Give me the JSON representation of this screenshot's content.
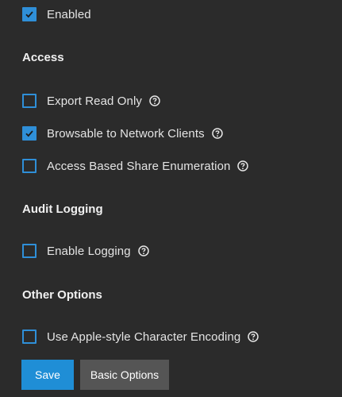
{
  "options": {
    "enabled": {
      "label": "Enabled",
      "checked": true
    },
    "access": {
      "title": "Access",
      "items": [
        {
          "label": "Export Read Only",
          "checked": false
        },
        {
          "label": "Browsable to Network Clients",
          "checked": true
        },
        {
          "label": "Access Based Share Enumeration",
          "checked": false
        }
      ]
    },
    "audit": {
      "title": "Audit Logging",
      "items": [
        {
          "label": "Enable Logging",
          "checked": false
        }
      ]
    },
    "other": {
      "title": "Other Options",
      "items": [
        {
          "label": "Use Apple-style Character Encoding",
          "checked": false
        }
      ]
    }
  },
  "buttons": {
    "save_label": "Save",
    "basic_options_label": "Basic Options"
  },
  "colors": {
    "background": "#2b2b2b",
    "accent": "#1f8ed6",
    "secondary_button": "#555555"
  },
  "icons": {
    "help": "help-circle-icon",
    "check": "checkmark-icon"
  }
}
